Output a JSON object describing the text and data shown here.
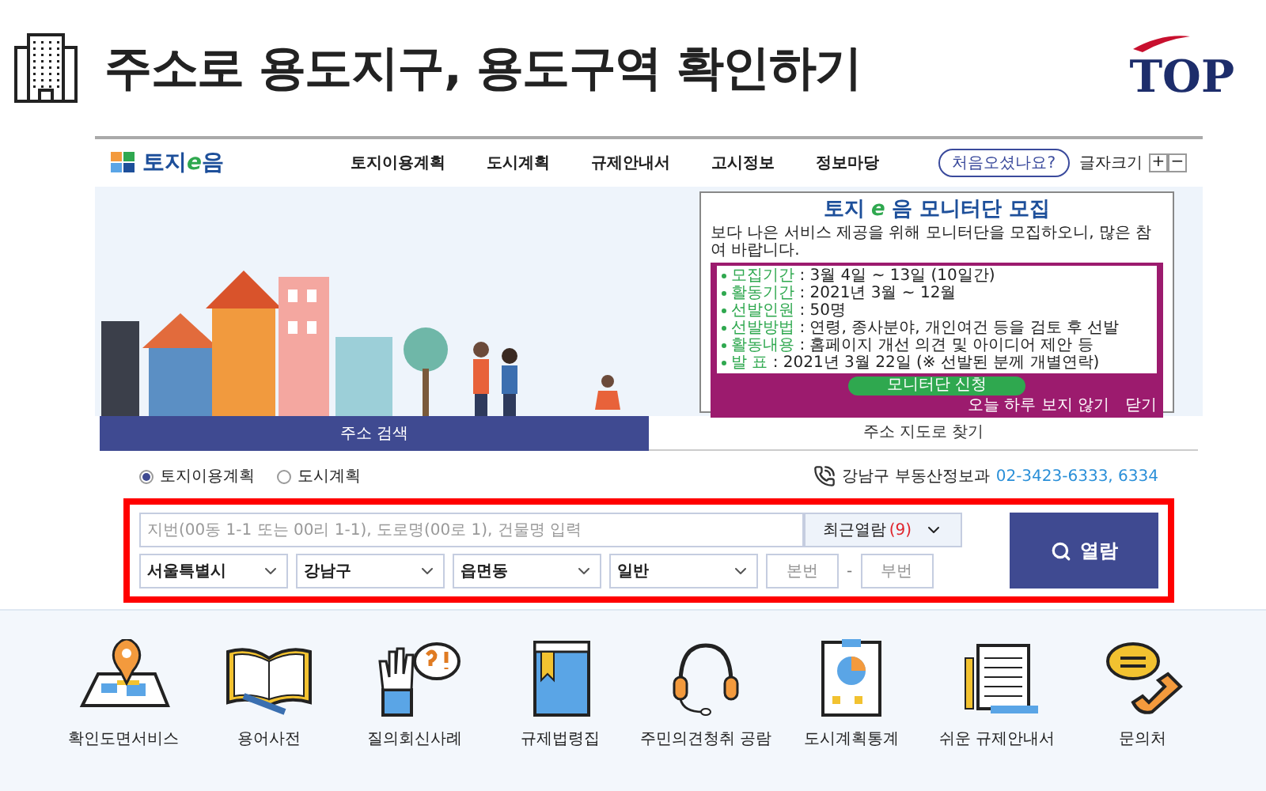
{
  "header": {
    "title": "주소로 용도지구, 용도구역 확인하기",
    "logo": "TOP"
  },
  "site": {
    "logo": [
      "토지",
      "e",
      "음"
    ],
    "nav": [
      "토지이용계획",
      "도시계획",
      "규제안내서",
      "고시정보",
      "정보마당"
    ],
    "help_button": "처음오셨나요?",
    "font_size": {
      "label": "글자크기",
      "plus": "+",
      "minus": "−"
    }
  },
  "popup": {
    "title": [
      "토지",
      "e",
      "음 모니터단 모집"
    ],
    "intro": "보다 나은 서비스 제공을 위해 모니터단을 모집하오니, 많은 참여 바랍니다.",
    "items": [
      {
        "label": "모집기간",
        "text": ": 3월 4일 ~ 13일 (10일간)"
      },
      {
        "label": "활동기간",
        "text": ": 2021년 3월 ~ 12월"
      },
      {
        "label": "선발인원",
        "text": ": 50명"
      },
      {
        "label": "선발방법",
        "text": ": 연령, 종사분야, 개인여건 등을 검토 후 선발"
      },
      {
        "label": "활동내용",
        "text": ": 홈페이지 개선 의견 및 아이디어 제안 등"
      },
      {
        "label": "발   표",
        "text": ": 2021년 3월 22일 (※ 선발된 분께 개별연락)"
      }
    ],
    "apply_button": "모니터단 신청",
    "hide_today": "오늘 하루 보지 않기",
    "close": "닫기"
  },
  "search": {
    "tabs": [
      {
        "label": "주소 검색",
        "selected": true
      },
      {
        "label": "주소 지도로 찾기",
        "selected": false
      }
    ],
    "radios": [
      {
        "label": "토지이용계획",
        "selected": true
      },
      {
        "label": "도시계획",
        "selected": false
      }
    ],
    "contact": {
      "label": "강남구 부동산정보과",
      "phone": "02-3423-6333, 6334"
    },
    "query": {
      "placeholder": "지번(00동 1-1 또는 00리 1-1), 도로명(00로 1), 건물명 입력"
    },
    "recent": {
      "label": "최근열람",
      "count": "(9)"
    },
    "selects": [
      "서울특별시",
      "강남구",
      "읍면동",
      "일반"
    ],
    "main_number": {
      "placeholder": "본번"
    },
    "separator": "-",
    "sub_number": {
      "placeholder": "부번"
    },
    "submit": "열람"
  },
  "services": [
    "확인도면서비스",
    "용어사전",
    "질의회신사례",
    "규제법령집",
    "주민의견청취 공람",
    "도시계획통계",
    "쉬운 규제안내서",
    "문의처"
  ]
}
